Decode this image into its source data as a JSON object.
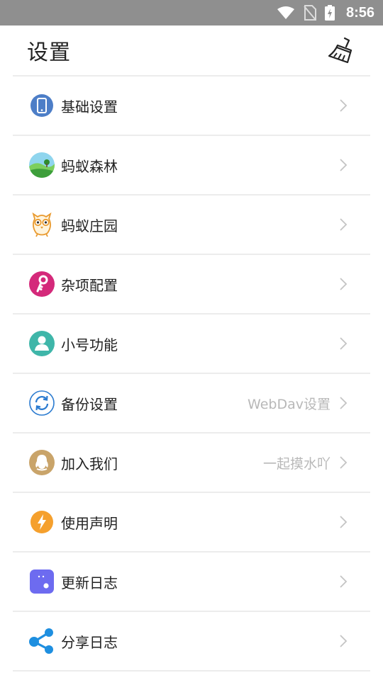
{
  "status_bar": {
    "time": "8:56"
  },
  "header": {
    "title": "设置"
  },
  "items": [
    {
      "label": "基础设置",
      "sub": "",
      "icon": "phone-icon"
    },
    {
      "label": "蚂蚁森林",
      "sub": "",
      "icon": "forest-icon"
    },
    {
      "label": "蚂蚁庄园",
      "sub": "",
      "icon": "chick-icon"
    },
    {
      "label": "杂项配置",
      "sub": "",
      "icon": "key-icon"
    },
    {
      "label": "小号功能",
      "sub": "",
      "icon": "user-icon"
    },
    {
      "label": "备份设置",
      "sub": "WebDav设置",
      "icon": "sync-icon"
    },
    {
      "label": "加入我们",
      "sub": "一起摸水吖",
      "icon": "qq-icon"
    },
    {
      "label": "使用声明",
      "sub": "",
      "icon": "lightning-icon"
    },
    {
      "label": "更新日志",
      "sub": "",
      "icon": "log-icon"
    },
    {
      "label": "分享日志",
      "sub": "",
      "icon": "share-icon"
    }
  ],
  "colors": {
    "status_bar_bg": "#8f8f8f",
    "divider": "#ececec",
    "sub_text": "#b8b8b8"
  }
}
